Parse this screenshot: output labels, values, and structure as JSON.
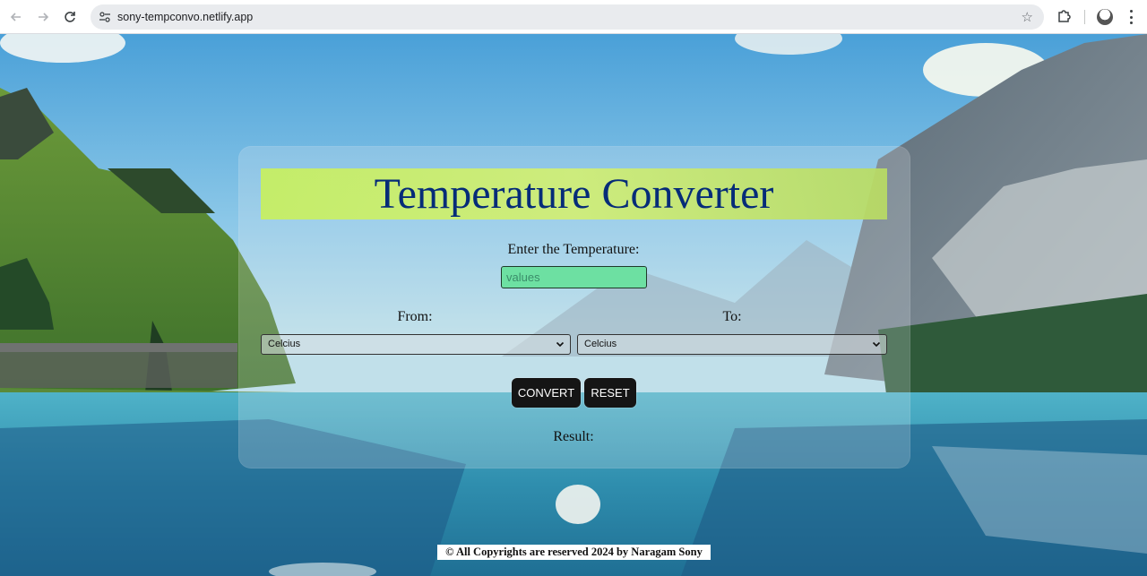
{
  "browser": {
    "url": "sony-tempconvo.netlify.app"
  },
  "converter": {
    "title": "Temperature Converter",
    "input_label": "Enter the Temperature:",
    "input_placeholder": "values",
    "input_value": "",
    "from_label": "From:",
    "to_label": "To:",
    "from_selected": "Celcius",
    "to_selected": "Celcius",
    "convert_label": "CONVERT",
    "reset_label": "RESET",
    "result_label": "Result:"
  },
  "footer": {
    "copyright": "© All Copyrights are reserved 2024 by Naragam Sony"
  },
  "icons": {
    "back": "back-arrow-icon",
    "forward": "forward-arrow-icon",
    "reload": "reload-icon",
    "site_info": "site-info-icon",
    "bookmark": "star-icon",
    "extensions": "puzzle-icon",
    "profile": "profile-avatar",
    "menu": "kebab-menu-icon"
  },
  "colors": {
    "title_text": "#062c78",
    "title_banner": "#c8f05e",
    "input_bg": "#6de0a2",
    "button_bg": "#151515",
    "button_text": "#ffffff"
  }
}
